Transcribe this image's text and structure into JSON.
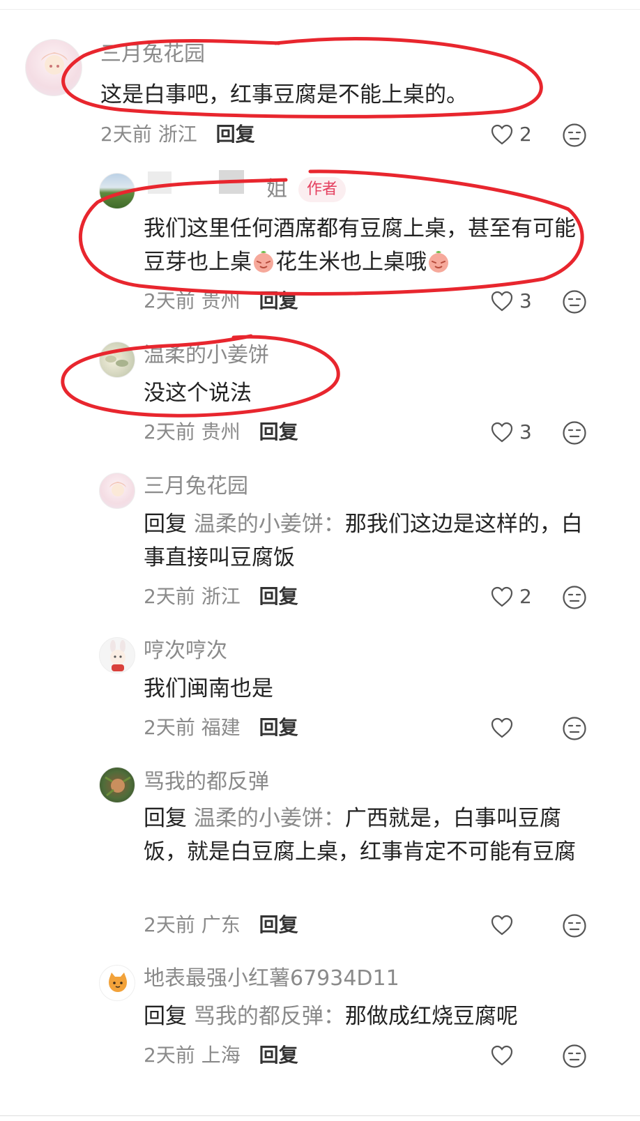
{
  "comments": [
    {
      "user": "三月兔花园",
      "text": "这是白事吧，红事豆腐是不能上桌的。",
      "time": "2天前",
      "location": "浙江",
      "reply_label": "回复",
      "likes": "2"
    },
    {
      "user": "姐",
      "tag": "作者",
      "text_a": "我们这里任何酒席都有豆腐上桌，甚至有可能豆芽也上桌",
      "text_b": "花生米也上桌哦",
      "time": "2天前",
      "location": "贵州",
      "reply_label": "回复",
      "likes": "3"
    },
    {
      "user": "温柔的小姜饼",
      "text": "没这个说法",
      "time": "2天前",
      "location": "贵州",
      "reply_label": "回复",
      "likes": "3"
    },
    {
      "user": "三月兔花园",
      "reply_prefix": "回复",
      "reply_to": "温柔的小姜饼：",
      "text": "那我们这边是这样的，白事直接叫豆腐饭",
      "time": "2天前",
      "location": "浙江",
      "reply_label": "回复",
      "likes": "2"
    },
    {
      "user": "哼次哼次",
      "text": "我们闽南也是",
      "time": "2天前",
      "location": "福建",
      "reply_label": "回复",
      "likes": ""
    },
    {
      "user": "骂我的都反弹",
      "reply_prefix": "回复",
      "reply_to": "温柔的小姜饼：",
      "text": "广西就是，白事叫豆腐饭，就是白豆腐上桌，红事肯定不可能有豆腐",
      "time": "2天前",
      "location": "广东",
      "reply_label": "回复",
      "likes": ""
    },
    {
      "user": "地表最强小红薯67934D11",
      "reply_prefix": "回复",
      "reply_to": "骂我的都反弹：",
      "text": "那做成红烧豆腐呢",
      "time": "2天前",
      "location": "上海",
      "reply_label": "回复",
      "likes": ""
    }
  ],
  "colors": {
    "annotation": "#e8262e",
    "author_tag": "#e4405f",
    "muted": "#8a8a8a"
  }
}
